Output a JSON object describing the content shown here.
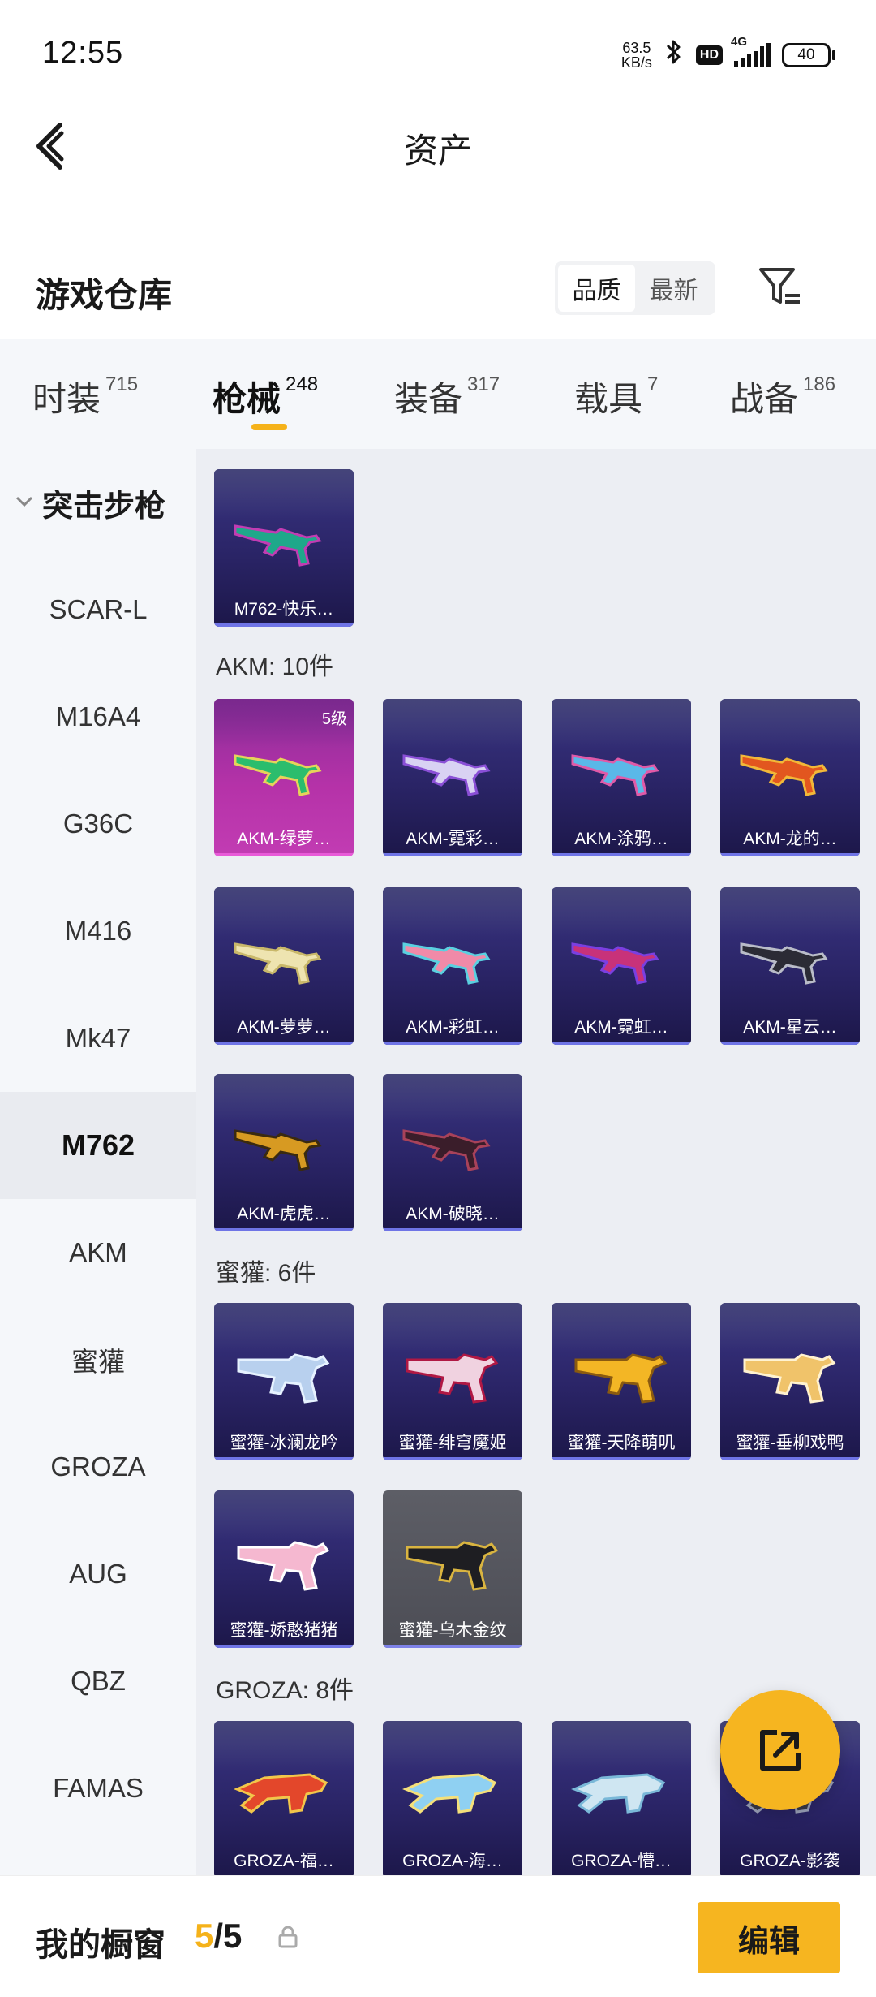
{
  "status": {
    "time": "12:55",
    "speed_value": "63.5",
    "speed_unit": "KB/s",
    "hd": "HD",
    "network": "4G",
    "battery": "40",
    "bluetooth_icon": "bluetooth-icon"
  },
  "header": {
    "title": "资产",
    "back_icon": "chevron-left-icon"
  },
  "warehouse": {
    "title": "游戏仓库",
    "sort_options": [
      "品质",
      "最新"
    ],
    "sort_active": "品质",
    "filter_icon": "filter-icon"
  },
  "tabs": [
    {
      "label": "时装",
      "count": "715"
    },
    {
      "label": "枪械",
      "count": "248",
      "active": true
    },
    {
      "label": "装备",
      "count": "317"
    },
    {
      "label": "载具",
      "count": "7"
    },
    {
      "label": "战备",
      "count": "186"
    }
  ],
  "sidebar": {
    "group": "突击步枪",
    "items": [
      "SCAR-L",
      "M16A4",
      "G36C",
      "M416",
      "Mk47",
      "M762",
      "AKM",
      "蜜獾",
      "GROZA",
      "AUG",
      "QBZ",
      "FAMAS"
    ],
    "active": "M762"
  },
  "content": {
    "top_cards": [
      {
        "name": "M762-快乐…"
      }
    ],
    "sections": [
      {
        "label": "AKM: 10件",
        "cards": [
          {
            "name": "AKM-绿萝…",
            "level": "5级"
          },
          {
            "name": "AKM-霓彩…"
          },
          {
            "name": "AKM-涂鸦…"
          },
          {
            "name": "AKM-龙的…"
          },
          {
            "name": "AKM-萝萝…"
          },
          {
            "name": "AKM-彩虹…"
          },
          {
            "name": "AKM-霓虹…"
          },
          {
            "name": "AKM-星云…"
          },
          {
            "name": "AKM-虎虎…"
          },
          {
            "name": "AKM-破晓…"
          }
        ]
      },
      {
        "label": "蜜獾: 6件",
        "cards": [
          {
            "name": "蜜獾-冰澜龙吟"
          },
          {
            "name": "蜜獾-绯穹魔姬"
          },
          {
            "name": "蜜獾-天降萌叽"
          },
          {
            "name": "蜜獾-垂柳戏鸭"
          },
          {
            "name": "蜜獾-娇憨猪猪"
          },
          {
            "name": "蜜獾-乌木金纹"
          }
        ]
      },
      {
        "label": "GROZA: 8件",
        "cards": [
          {
            "name": "GROZA-福…"
          },
          {
            "name": "GROZA-海…"
          },
          {
            "name": "GROZA-懵…"
          },
          {
            "name": "GROZA-影袭"
          }
        ]
      }
    ]
  },
  "fab": {
    "icon": "share-external-icon"
  },
  "bottom": {
    "title": "我的橱窗",
    "current": "5",
    "separator": "/",
    "total": "5",
    "lock_icon": "lock-icon",
    "edit_label": "编辑"
  },
  "colors": {
    "accent": "#f6b520",
    "card_purple": "#2a2466",
    "card_pink": "#b532a8"
  }
}
